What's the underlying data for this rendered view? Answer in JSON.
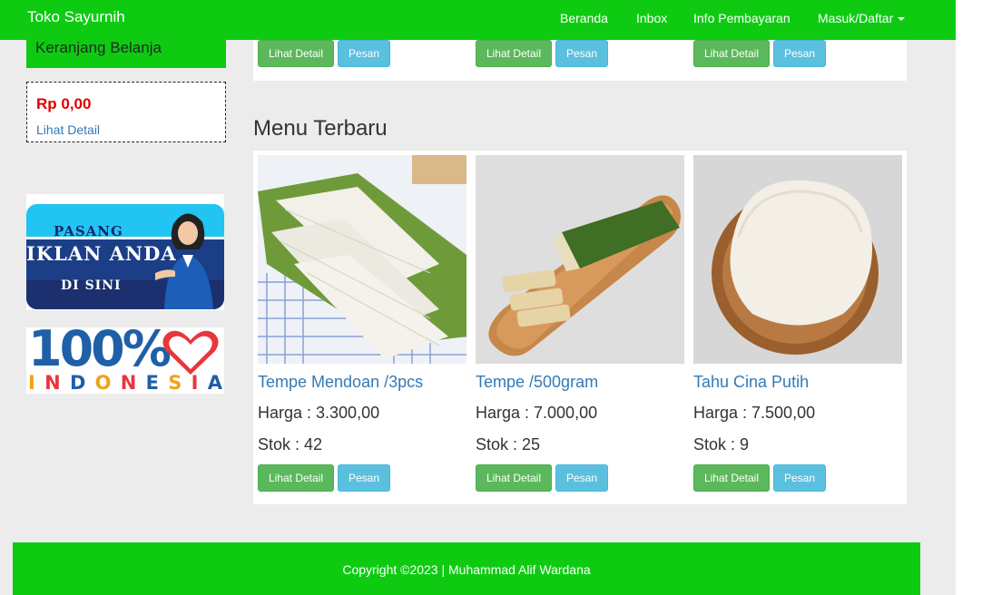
{
  "navbar": {
    "brand": "Toko Sayurnih",
    "items": [
      {
        "label": "Beranda"
      },
      {
        "label": "Inbox"
      },
      {
        "label": "Info Pembayaran"
      },
      {
        "label": "Masuk/Daftar"
      }
    ],
    "bg_color": "#0ecb12"
  },
  "sidebar": {
    "cart_title": "Keranjang Belanja",
    "cart_total": "Rp 0,00",
    "cart_link": "Lihat Detail",
    "ad_banner": {
      "line1": "PASANG",
      "line2": "IKLAN ANDA",
      "line3": "DI SINI"
    },
    "indonesia_banner": {
      "number": "100%",
      "word": [
        "I",
        "N",
        "D",
        "O",
        "N",
        "E",
        "S",
        "I",
        "A"
      ]
    }
  },
  "top_products": [
    {
      "detail_label": "Lihat Detail",
      "order_label": "Pesan"
    },
    {
      "detail_label": "Lihat Detail",
      "order_label": "Pesan"
    },
    {
      "detail_label": "Lihat Detail",
      "order_label": "Pesan"
    }
  ],
  "menu_section": {
    "title": "Menu Terbaru",
    "products": [
      {
        "name": "Tempe Mendoan /3pcs",
        "price": "Harga : 3.300,00",
        "stock": "Stok : 42",
        "detail_label": "Lihat Detail",
        "order_label": "Pesan",
        "image_icon": "tempe-mendoan-image"
      },
      {
        "name": "Tempe /500gram",
        "price": "Harga : 7.000,00",
        "stock": "Stok : 25",
        "detail_label": "Lihat Detail",
        "order_label": "Pesan",
        "image_icon": "tempe-image"
      },
      {
        "name": "Tahu Cina Putih",
        "price": "Harga : 7.500,00",
        "stock": "Stok : 9",
        "detail_label": "Lihat Detail",
        "order_label": "Pesan",
        "image_icon": "tahu-image"
      }
    ]
  },
  "footer": {
    "text": "Copyright ©2023 | Muhammad Alif Wardana"
  },
  "colors": {
    "accent_green": "#0ecb12",
    "btn_success": "#5cb85c",
    "btn_info": "#5bc0de",
    "link": "#337ab7",
    "price_red": "#e00000"
  }
}
